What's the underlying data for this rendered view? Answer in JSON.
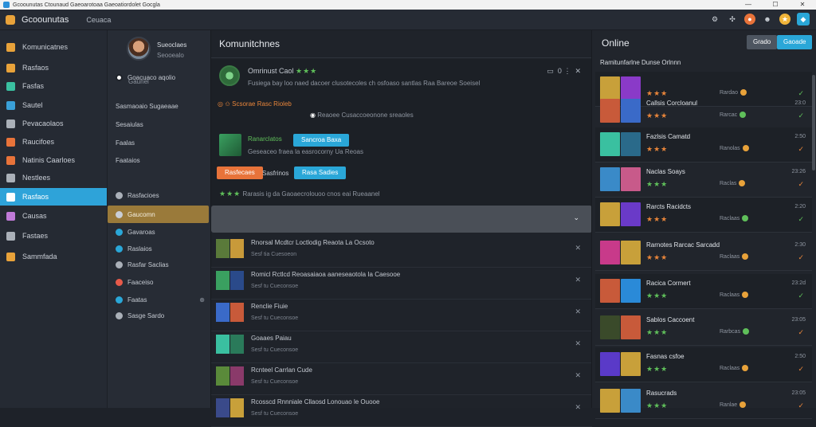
{
  "window": {
    "title": "Gcoounutas Ctounaud Gaeoarotoaa Gaeoatiordolet Gocgla"
  },
  "topbar": {
    "brand": "Gcoounutas",
    "nav": "Ceuaca"
  },
  "leftnav": {
    "items": [
      {
        "label": "Komunicatnes",
        "color": "#e8a23a"
      },
      {
        "label": "Rasfaos",
        "color": "#e8a23a"
      },
      {
        "label": "Fasfas",
        "color": "#3ac0a0"
      },
      {
        "label": "Sautel",
        "color": "#3aa0d8"
      },
      {
        "label": "Pevacaolaos",
        "color": "#aab0b8"
      },
      {
        "label": "Raucifoes",
        "color": "#e8733a"
      },
      {
        "label": "Natinis Caarloes",
        "color": "#e8733a"
      },
      {
        "label": "Nestlees",
        "color": "#aab0b8"
      },
      {
        "label": "Rasfaos",
        "color": "#2aa7d8"
      },
      {
        "label": "Causas",
        "color": "#c07ad8"
      },
      {
        "label": "Fastaes",
        "color": "#aab0b8"
      },
      {
        "label": "Sammfada",
        "color": "#e8a23a"
      }
    ]
  },
  "friends": {
    "profile_name": "Sueoclaes",
    "profile_status": "Seooealo",
    "status_item": "Goacuaco aqolio",
    "status_sub": "Gaunel",
    "items": [
      "Sasmaoaio Sugaeaae",
      "Sesaiulas",
      "Faalas",
      "Faataios",
      "Rasfacioes",
      "Gaucomn",
      "Gavaroas",
      "Raslaios",
      "Rasfar Saclias",
      "Faaceiso",
      "Faatas",
      "Sasge Sardo"
    ]
  },
  "main": {
    "title": "Komunitchnes",
    "post": {
      "author": "Omrinust Caol",
      "text": "Fusiega bay loo naed dacoer clusotecoles ch osfoaso santlas Raa Bareoe Soeisel",
      "notice": "Scsorae Rasc Rioleb",
      "notice2": "Reaoee Cusaccoeonone sreaoles",
      "item1_title": "Ranarclatos",
      "item1_btn": "Sancroa Baxa",
      "item1_text": "Geseaceo fraea la easrocorny Ua Reoas",
      "btn_orange": "Rasfecaes",
      "btn_label": "Sasfrinos",
      "btn_blue": "Rasa Sadies",
      "stars_text": "Rarasis ig da Gaoaecrolouoo cnos eai Rueaanel"
    },
    "rows": [
      {
        "name": "Rnorsal Mcdtcr Loctlodig Reaota La Ocsoto",
        "sub": "Sesf tia Cuesoeon"
      },
      {
        "name": "Romicl Rctlcd Reoasaiaoa aaneseaotola Ia Caesooe",
        "sub": "Sesf tu Cueconsoe"
      },
      {
        "name": "Renclie Fiuie",
        "sub": "Sesf tu Cueconsoe"
      },
      {
        "name": "Goaaes Paiau",
        "sub": "Sesf tu Cueconsoe"
      },
      {
        "name": "Rcnteel Carrlan Cude",
        "sub": "Sesf tu Cueconsoe"
      },
      {
        "name": "Rcosscd Rnnniale Cllaosd Lonouao le Ouooe",
        "sub": "Sesf tu Cueconsoe"
      }
    ]
  },
  "online": {
    "title": "Online",
    "btn_gray": "Grado",
    "btn_blue": "Gaoade",
    "subtitle": "Ramitunfarlne Dunse Orlnnn",
    "rows": [
      {
        "name": "",
        "meta": "Rardao",
        "time": "",
        "stars": "orange",
        "check": "#5fbf5a"
      },
      {
        "name": "Callsis Corcloanul",
        "meta": "Rarcac",
        "time": "23:0",
        "stars": "orange",
        "check": "#5fbf5a"
      },
      {
        "name": "Fazlsis Camatd",
        "meta": "Ranolas",
        "time": "2:50",
        "stars": "orange",
        "check": "#e8853a"
      },
      {
        "name": "Naclas Soays",
        "meta": "Raclas",
        "time": "23:26",
        "stars": "green",
        "check": "#e8853a"
      },
      {
        "name": "Rarcts Racidcts",
        "meta": "Raclaas",
        "time": "2:20",
        "stars": "orange",
        "check": "#5fbf5a"
      },
      {
        "name": "Rarnotes Rarcac Sarcadd",
        "meta": "Raclaas",
        "time": "2:30",
        "stars": "orange",
        "check": "#e8853a"
      },
      {
        "name": "Racica Cormert",
        "meta": "Raclaas",
        "time": "23:2d",
        "stars": "green",
        "check": "#5fbf5a"
      },
      {
        "name": "Sablos Caccoent",
        "meta": "Rarbcas",
        "time": "23:05",
        "stars": "green",
        "check": "#e8853a"
      },
      {
        "name": "Fasnas csfoe",
        "meta": "Raclaas",
        "time": "2:50",
        "stars": "green",
        "check": "#e8853a"
      },
      {
        "name": "Rasucrads",
        "meta": "Ranlae",
        "time": "23:05",
        "stars": "green",
        "check": "#e8853a"
      }
    ]
  }
}
